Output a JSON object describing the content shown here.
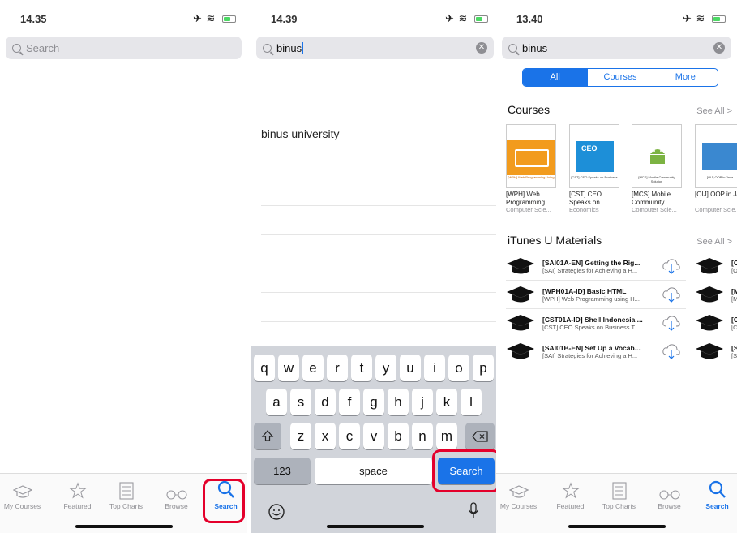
{
  "panels": [
    {
      "time": "14.35",
      "search": {
        "placeholder": "Search"
      }
    },
    {
      "time": "14.39",
      "search": {
        "value": "binus"
      },
      "suggestions": [
        "binus university"
      ],
      "keyboard": {
        "row1": [
          "q",
          "w",
          "e",
          "r",
          "t",
          "y",
          "u",
          "i",
          "o",
          "p"
        ],
        "row2": [
          "a",
          "s",
          "d",
          "f",
          "g",
          "h",
          "j",
          "k",
          "l"
        ],
        "row3": [
          "z",
          "x",
          "c",
          "v",
          "b",
          "n",
          "m"
        ],
        "numbers": "123",
        "space": "space",
        "search": "Search"
      }
    },
    {
      "time": "13.40",
      "search": {
        "value": "binus"
      },
      "segments": [
        "All",
        "Courses",
        "More"
      ],
      "courses_header": "Courses",
      "materials_header": "iTunes U Materials",
      "see_all": "See All >",
      "courses": [
        {
          "name": "[WPH] Web Programming...",
          "category": "Computer Scie...",
          "cover_title": "[WPH] Web Programming Using",
          "cover_color": "#f29b1d"
        },
        {
          "name": "[CST] CEO Speaks on...",
          "category": "Economics",
          "cover_title": "[CST] CEO Speaks on Business",
          "cover_color": "#1d8fd8"
        },
        {
          "name": "[MCS] Mobile Community...",
          "category": "Computer Scie...",
          "cover_title": "[MCS] Mobile Community Solution",
          "cover_color": "#ffffff"
        },
        {
          "name": "[OIJ] OOP in Java",
          "category": "Computer Scie...",
          "cover_title": "[OIJ] OOP in Java",
          "cover_color": "#3a88d0"
        }
      ],
      "materials": [
        {
          "title": "[SAI01A-EN] Getting the Rig...",
          "subtitle": "[SAI] Strategies for Achieving a H...",
          "peek_title": "[O",
          "peek_sub": "[O"
        },
        {
          "title": "[WPH01A-ID] Basic HTML",
          "subtitle": "[WPH] Web Programming using H...",
          "peek_title": "[M",
          "peek_sub": "[M"
        },
        {
          "title": "[CST01A-ID] Shell Indonesia ...",
          "subtitle": "[CST] CEO Speaks on Business T...",
          "peek_title": "[C",
          "peek_sub": "[C"
        },
        {
          "title": "[SAI01B-EN] Set Up a Vocab...",
          "subtitle": "[SAI] Strategies for Achieving a H...",
          "peek_title": "[S",
          "peek_sub": "[S"
        }
      ]
    }
  ],
  "tabbar": {
    "tabs": [
      "My Courses",
      "Featured",
      "Top Charts",
      "Browse",
      "Search"
    ],
    "active": "Search"
  },
  "colors": {
    "accent": "#1a73e8",
    "highlight": "#e4002b"
  }
}
